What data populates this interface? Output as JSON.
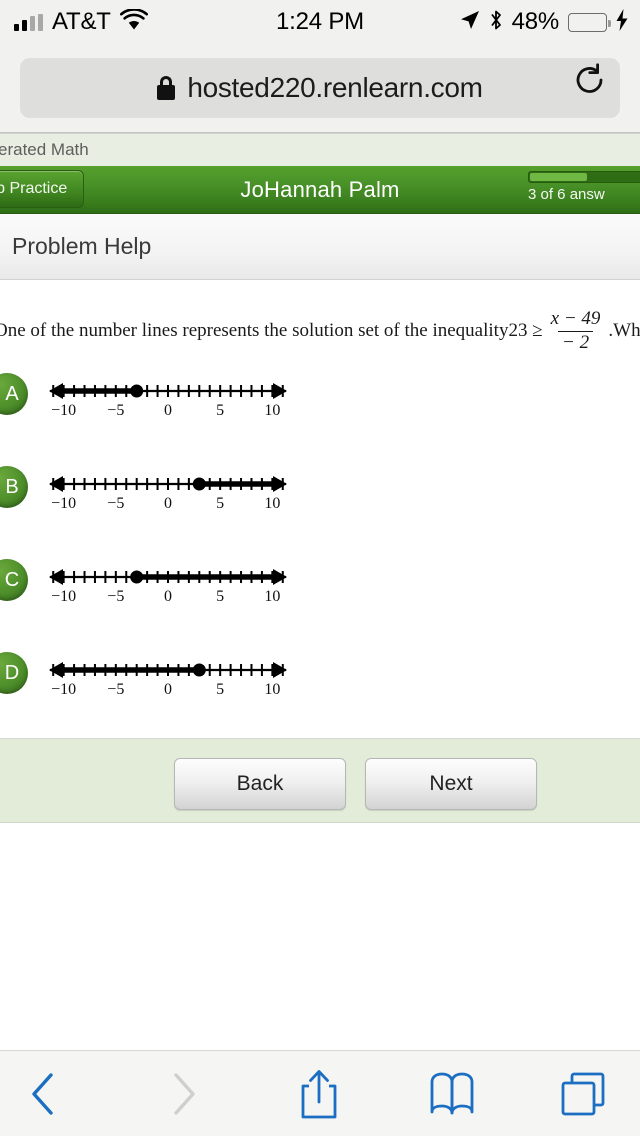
{
  "status_bar": {
    "carrier": "AT&T",
    "time": "1:24 PM",
    "battery_percent": "48%",
    "icons": [
      "signal-bars-icon",
      "wifi-icon",
      "location-arrow-icon",
      "bluetooth-icon",
      "battery-icon",
      "charging-bolt-icon"
    ]
  },
  "browser": {
    "url": "hosted220.renlearn.com",
    "lock_icon": "lock-icon",
    "reload_icon": "reload-icon",
    "toolbar": {
      "back": "back-chevron-icon",
      "forward": "forward-chevron-icon",
      "share": "share-icon",
      "bookmarks": "book-icon",
      "tabs": "tabs-icon"
    }
  },
  "page": {
    "title_strip": "erated Math",
    "header": {
      "stop_practice_label": "top Practice",
      "user_name": "JoHannah Palm",
      "progress_label": "3 of 6 answ",
      "progress_percent": 50,
      "accent_color": "#4a9329"
    },
    "subheader": {
      "problem_help_label": "Problem Help"
    },
    "question": {
      "lead": "One of the number lines represents the solution set of the inequality",
      "relation": "23 ≥",
      "fraction_numerator": "x − 49",
      "fraction_denominator": "− 2",
      "period": ".",
      "tail": "Which number line is it?"
    },
    "choices": [
      {
        "letter": "A",
        "axis_min": -11.5,
        "axis_max": 11.5,
        "tick_labels": [
          "−10",
          "−5",
          "0",
          "5",
          "10"
        ],
        "tick_label_values": [
          -10,
          -5,
          0,
          5,
          10
        ],
        "point": -3,
        "point_type": "closed",
        "shade_direction": "left"
      },
      {
        "letter": "B",
        "axis_min": -11.5,
        "axis_max": 11.5,
        "tick_labels": [
          "−10",
          "−5",
          "0",
          "5",
          "10"
        ],
        "tick_label_values": [
          -10,
          -5,
          0,
          5,
          10
        ],
        "point": 3,
        "point_type": "closed",
        "shade_direction": "right"
      },
      {
        "letter": "C",
        "axis_min": -11.5,
        "axis_max": 11.5,
        "tick_labels": [
          "−10",
          "−5",
          "0",
          "5",
          "10"
        ],
        "tick_label_values": [
          -10,
          -5,
          0,
          5,
          10
        ],
        "point": -3,
        "point_type": "closed",
        "shade_direction": "right"
      },
      {
        "letter": "D",
        "axis_min": -11.5,
        "axis_max": 11.5,
        "tick_labels": [
          "−10",
          "−5",
          "0",
          "5",
          "10"
        ],
        "tick_label_values": [
          -10,
          -5,
          0,
          5,
          10
        ],
        "point": 3,
        "point_type": "closed",
        "shade_direction": "left"
      }
    ],
    "nav": {
      "back_label": "Back",
      "next_label": "Next"
    }
  }
}
